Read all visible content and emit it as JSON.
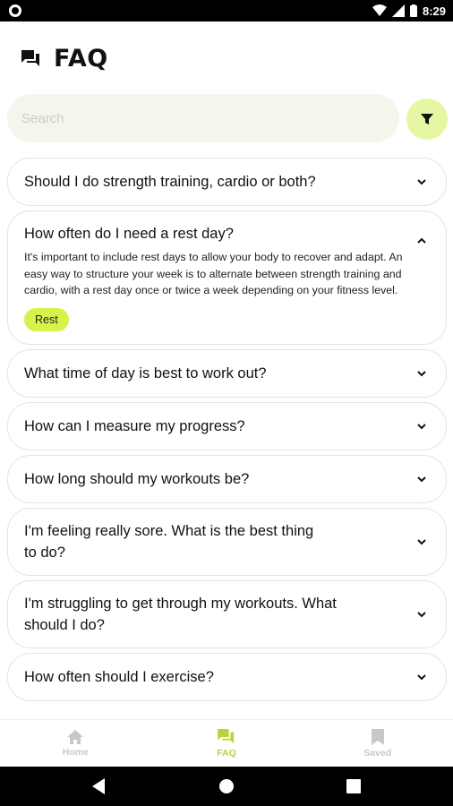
{
  "status_bar": {
    "time": "8:29"
  },
  "header": {
    "title": "FAQ"
  },
  "search": {
    "placeholder": "Search"
  },
  "faqs": [
    {
      "question": "Should I do strength training, cardio or both?"
    },
    {
      "question": "How often do I need a rest day?",
      "answer": "It's important to include rest days to allow your body to recover and adapt. An easy way to structure your week is to alternate between strength training and cardio, with a rest day once or twice a week depending on your fitness level.",
      "tag": "Rest"
    },
    {
      "question": "What time of day is best to work out?"
    },
    {
      "question": "How can I measure my progress?"
    },
    {
      "question": "How long should my workouts be?"
    },
    {
      "question": "I'm feeling really sore. What is the best thing to do?"
    },
    {
      "question": "I'm struggling to get through my workouts. What should I do?"
    },
    {
      "question": "How often should I exercise?"
    }
  ],
  "bottom_nav": {
    "home": "Home",
    "faq": "FAQ",
    "saved": "Saved"
  },
  "colors": {
    "accent": "#d8f24a",
    "accent_soft": "#e6f7a3",
    "active_nav": "#b5d53a"
  }
}
